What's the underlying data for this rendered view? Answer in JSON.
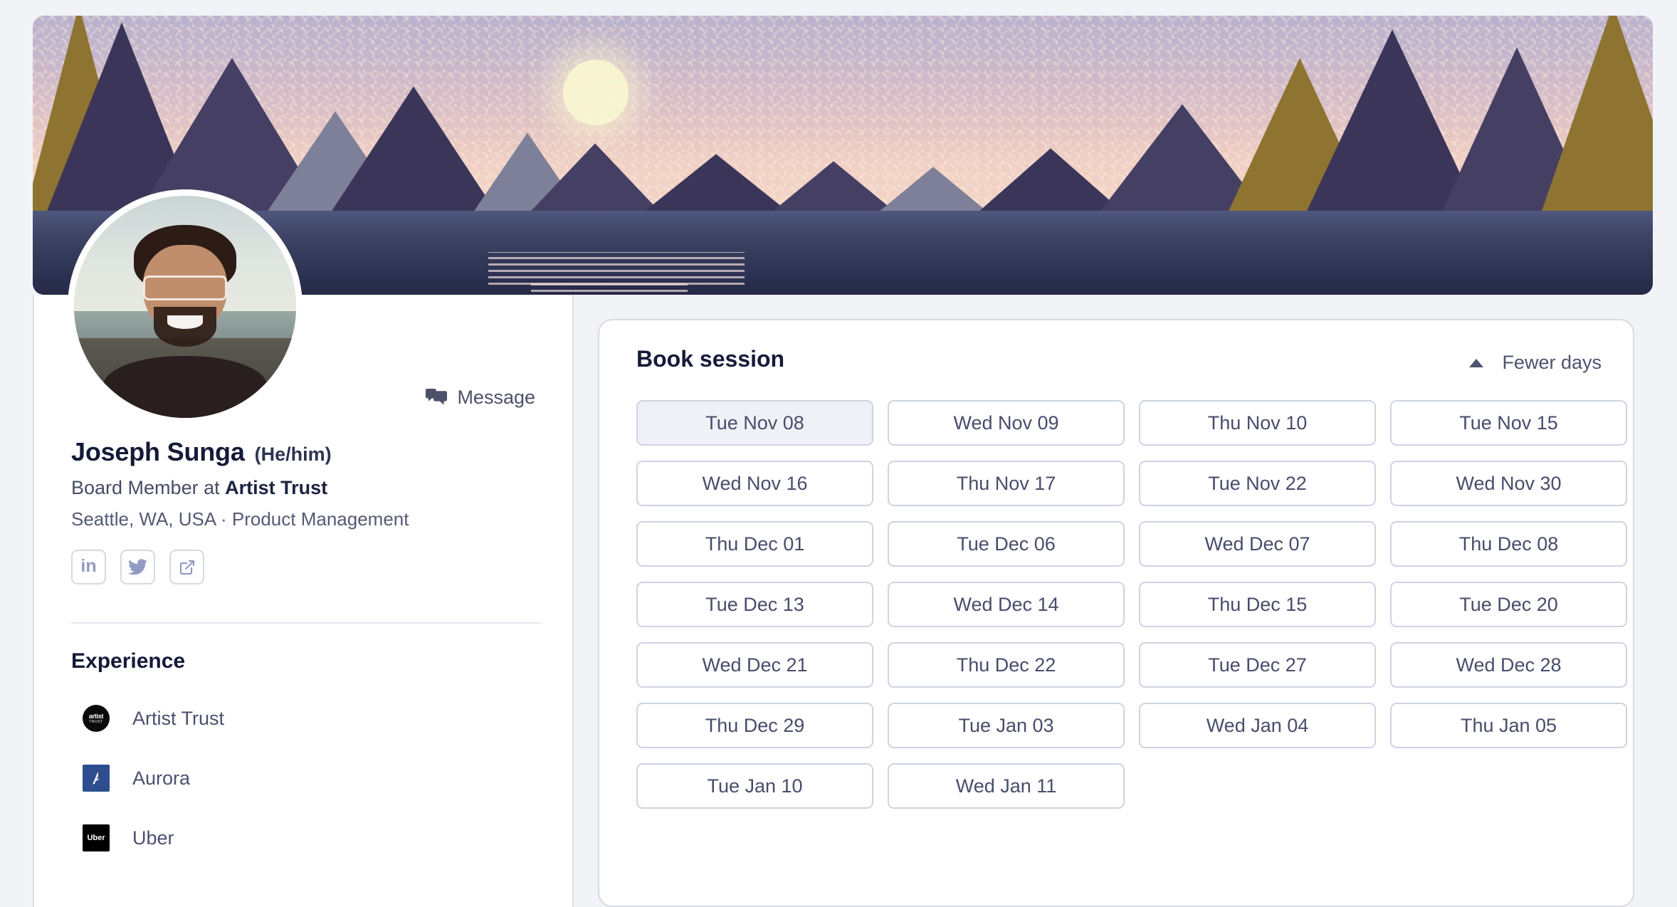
{
  "banner": {
    "alt": "pixel-art sunset over mountains and water",
    "sky_colors": [
      "#b9b2cd",
      "#d3bcc8",
      "#efcfc5"
    ],
    "sun_color": "#f7f5cf",
    "water_color": "#3f4466",
    "mountain_color": "#453f63"
  },
  "profile": {
    "avatar_alt": "Joseph Sunga profile photo",
    "message_label": "Message",
    "name": "Joseph Sunga",
    "pronouns": "(He/him)",
    "headline_prefix": "Board Member at ",
    "headline_company": "Artist Trust",
    "location": "Seattle, WA, USA · Product Management",
    "socials": [
      {
        "name": "linkedin",
        "glyph": "in"
      },
      {
        "name": "twitter",
        "glyph": "bird"
      },
      {
        "name": "external-link",
        "glyph": "arrow-out-of-box"
      }
    ],
    "experience_title": "Experience",
    "experience": [
      {
        "company": "Artist Trust",
        "logo": "artist-trust-logo",
        "logo_bg": "#0a0a0a",
        "logo_line1": "artist",
        "logo_line2": "TRUST"
      },
      {
        "company": "Aurora",
        "logo": "aurora-logo",
        "logo_bg": "#2e4d8e",
        "logo_glyph": "A"
      },
      {
        "company": "Uber",
        "logo": "uber-logo",
        "logo_bg": "#000000",
        "logo_text": "Uber"
      }
    ]
  },
  "booking": {
    "title": "Book session",
    "toggle_label": "Fewer days",
    "toggle_icon": "caret-up-icon",
    "selected_date": "Tue Nov 08",
    "dates": [
      "Tue Nov 08",
      "Wed Nov 09",
      "Thu Nov 10",
      "Tue Nov 15",
      "Wed Nov 16",
      "Thu Nov 17",
      "Tue Nov 22",
      "Wed Nov 30",
      "Thu Dec 01",
      "Tue Dec 06",
      "Wed Dec 07",
      "Thu Dec 08",
      "Tue Dec 13",
      "Wed Dec 14",
      "Thu Dec 15",
      "Tue Dec 20",
      "Wed Dec 21",
      "Thu Dec 22",
      "Tue Dec 27",
      "Wed Dec 28",
      "Thu Dec 29",
      "Tue Jan 03",
      "Wed Jan 04",
      "Thu Jan 05",
      "Tue Jan 10",
      "Wed Jan 11"
    ]
  },
  "theme": {
    "page_bg": "#f1f3f7",
    "card_bg": "#ffffff",
    "border": "#d7dae6",
    "text_dark": "#141a38",
    "text_body": "#474d6b",
    "selected_bg": "#f0f1f7",
    "social_icon": "#919bc4"
  }
}
